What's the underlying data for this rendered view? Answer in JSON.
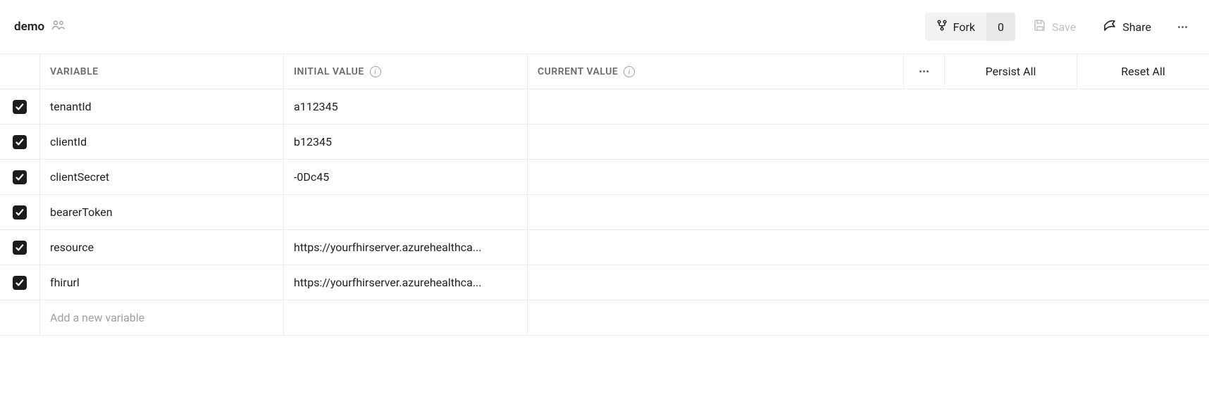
{
  "header": {
    "title": "demo",
    "fork_label": "Fork",
    "fork_count": "0",
    "save_label": "Save",
    "share_label": "Share"
  },
  "table": {
    "headers": {
      "variable": "VARIABLE",
      "initial_value": "INITIAL VALUE",
      "current_value": "CURRENT VALUE",
      "persist_all": "Persist All",
      "reset_all": "Reset All"
    },
    "rows": [
      {
        "enabled": true,
        "variable": "tenantId",
        "initial_value": "a112345",
        "current_value": ""
      },
      {
        "enabled": true,
        "variable": "clientId",
        "initial_value": "b12345",
        "current_value": ""
      },
      {
        "enabled": true,
        "variable": "clientSecret",
        "initial_value": "-0Dc45",
        "current_value": ""
      },
      {
        "enabled": true,
        "variable": "bearerToken",
        "initial_value": "",
        "current_value": ""
      },
      {
        "enabled": true,
        "variable": "resource",
        "initial_value": "https://yourfhirserver.azurehealthca...",
        "current_value": ""
      },
      {
        "enabled": true,
        "variable": "fhirurl",
        "initial_value": "https://yourfhirserver.azurehealthca...",
        "current_value": ""
      }
    ],
    "add_placeholder": "Add a new variable"
  }
}
